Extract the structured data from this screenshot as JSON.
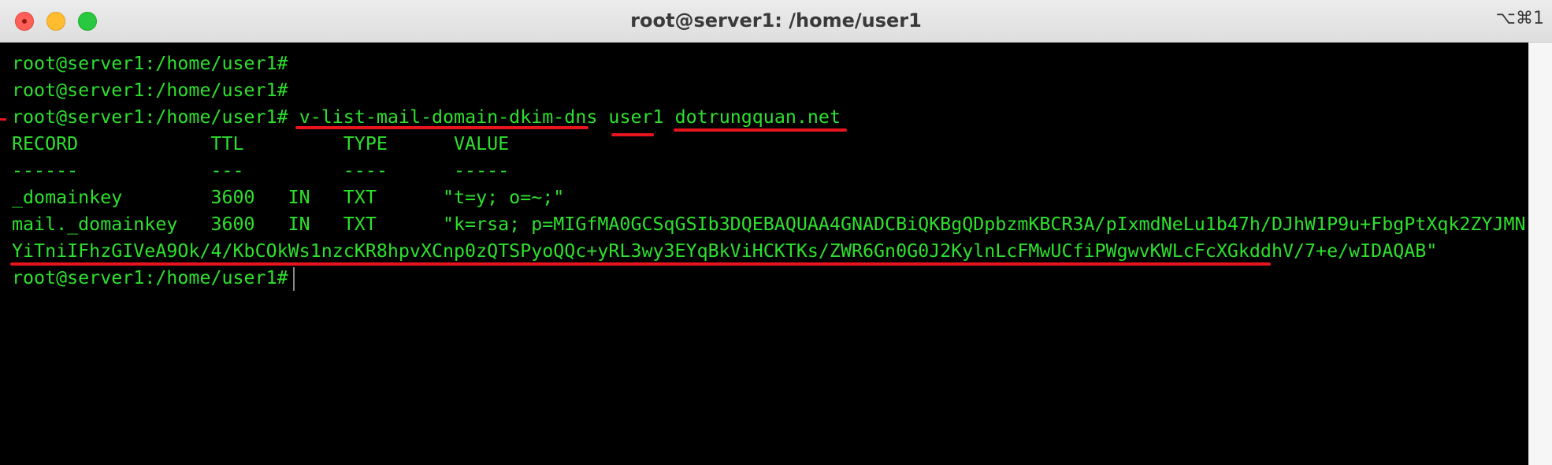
{
  "window": {
    "title": "root@server1: /home/user1",
    "shortcut": "⌥⌘1"
  },
  "colors": {
    "terminal_bg": "#000000",
    "terminal_text": "#2ee02e",
    "annotation_red": "#e8141e",
    "close": "#fe5f57",
    "minimize": "#febc2e",
    "maximize": "#28c840"
  },
  "terminal": {
    "prompt": "root@server1:/home/user1#",
    "command": "v-list-mail-domain-dkim-dns",
    "arg_user": "user1",
    "arg_domain": "dotrungquan.net",
    "header": "RECORD            TTL         TYPE      VALUE",
    "separator": "------            ---         ----      -----",
    "row1": "_domainkey        3600   IN   TXT      \"t=y; o=~;\"",
    "row2": "mail._domainkey   3600   IN   TXT      \"k=rsa; p=MIGfMA0GCSqGSIb3DQEBAQUAA4GNADCBiQKBgQDpbzmKBCR3A/pIxmdNeLu1b47h/DJhW1P9u+FbgPtXqk2ZYJMN",
    "row2_cont": "YiTniIFhzGIVeA9Ok/4/KbCOkWs1nzcKR8hpvXCnp0zQTSPyoQQc+yRL3wy3EYqBkViHCKTKs/ZWR6Gn0G0J2KylnLcFMwUCfiPWgwvKWLcFcXGkddhV/7+e/wIDAQAB\""
  }
}
